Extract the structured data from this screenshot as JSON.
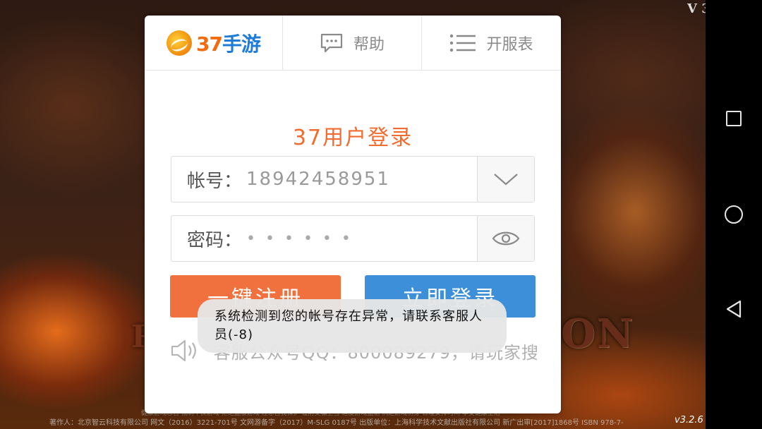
{
  "header": {
    "brand": {
      "number": "37",
      "text": "手游"
    },
    "help_label": "帮助",
    "servers_label": "开服表"
  },
  "login": {
    "title": "37用户登录",
    "account": {
      "label": "帐号：",
      "value": "18942458951"
    },
    "password": {
      "label": "密码：",
      "value": "••••••"
    },
    "register_button": "一键注册",
    "login_button": "立即登录",
    "notice_text": "客服公众号QQ：800089279，请玩家搜"
  },
  "toast": {
    "message": "系统检测到您的帐号存在异常，请联系客服人员(-8)"
  },
  "background": {
    "version_top": "V 3",
    "footer_line1": "著作人：北京智云科技有限公司  网文（2016）3221-701号  文网游备字（2017）M-SLG 0187号  出版单位：上海科学技术文献出版社有限公司  新广出审[2017]1868号  ISBN 978-7-",
    "footer_line2": "健康游戏忠告  抵制不良游戏  拒绝盗版游戏  注意自我保护  谨防受骗上当  适度游戏益脑  沉迷游戏伤身  合理安排时间  享受健康生活",
    "version_bottom": "v3.2.6",
    "game_logo": "ON"
  },
  "colors": {
    "accent_orange": "#f0713d",
    "accent_blue": "#3c8fd8",
    "title_orange": "#f26b2f"
  },
  "icons": {
    "help": "chat-bubble-icon",
    "servers": "list-icon",
    "dropdown": "chevron-down-icon",
    "show_password": "eye-icon",
    "notice": "speaker-icon",
    "nav_recent": "square-icon",
    "nav_home": "circle-icon",
    "nav_back": "triangle-back-icon"
  }
}
